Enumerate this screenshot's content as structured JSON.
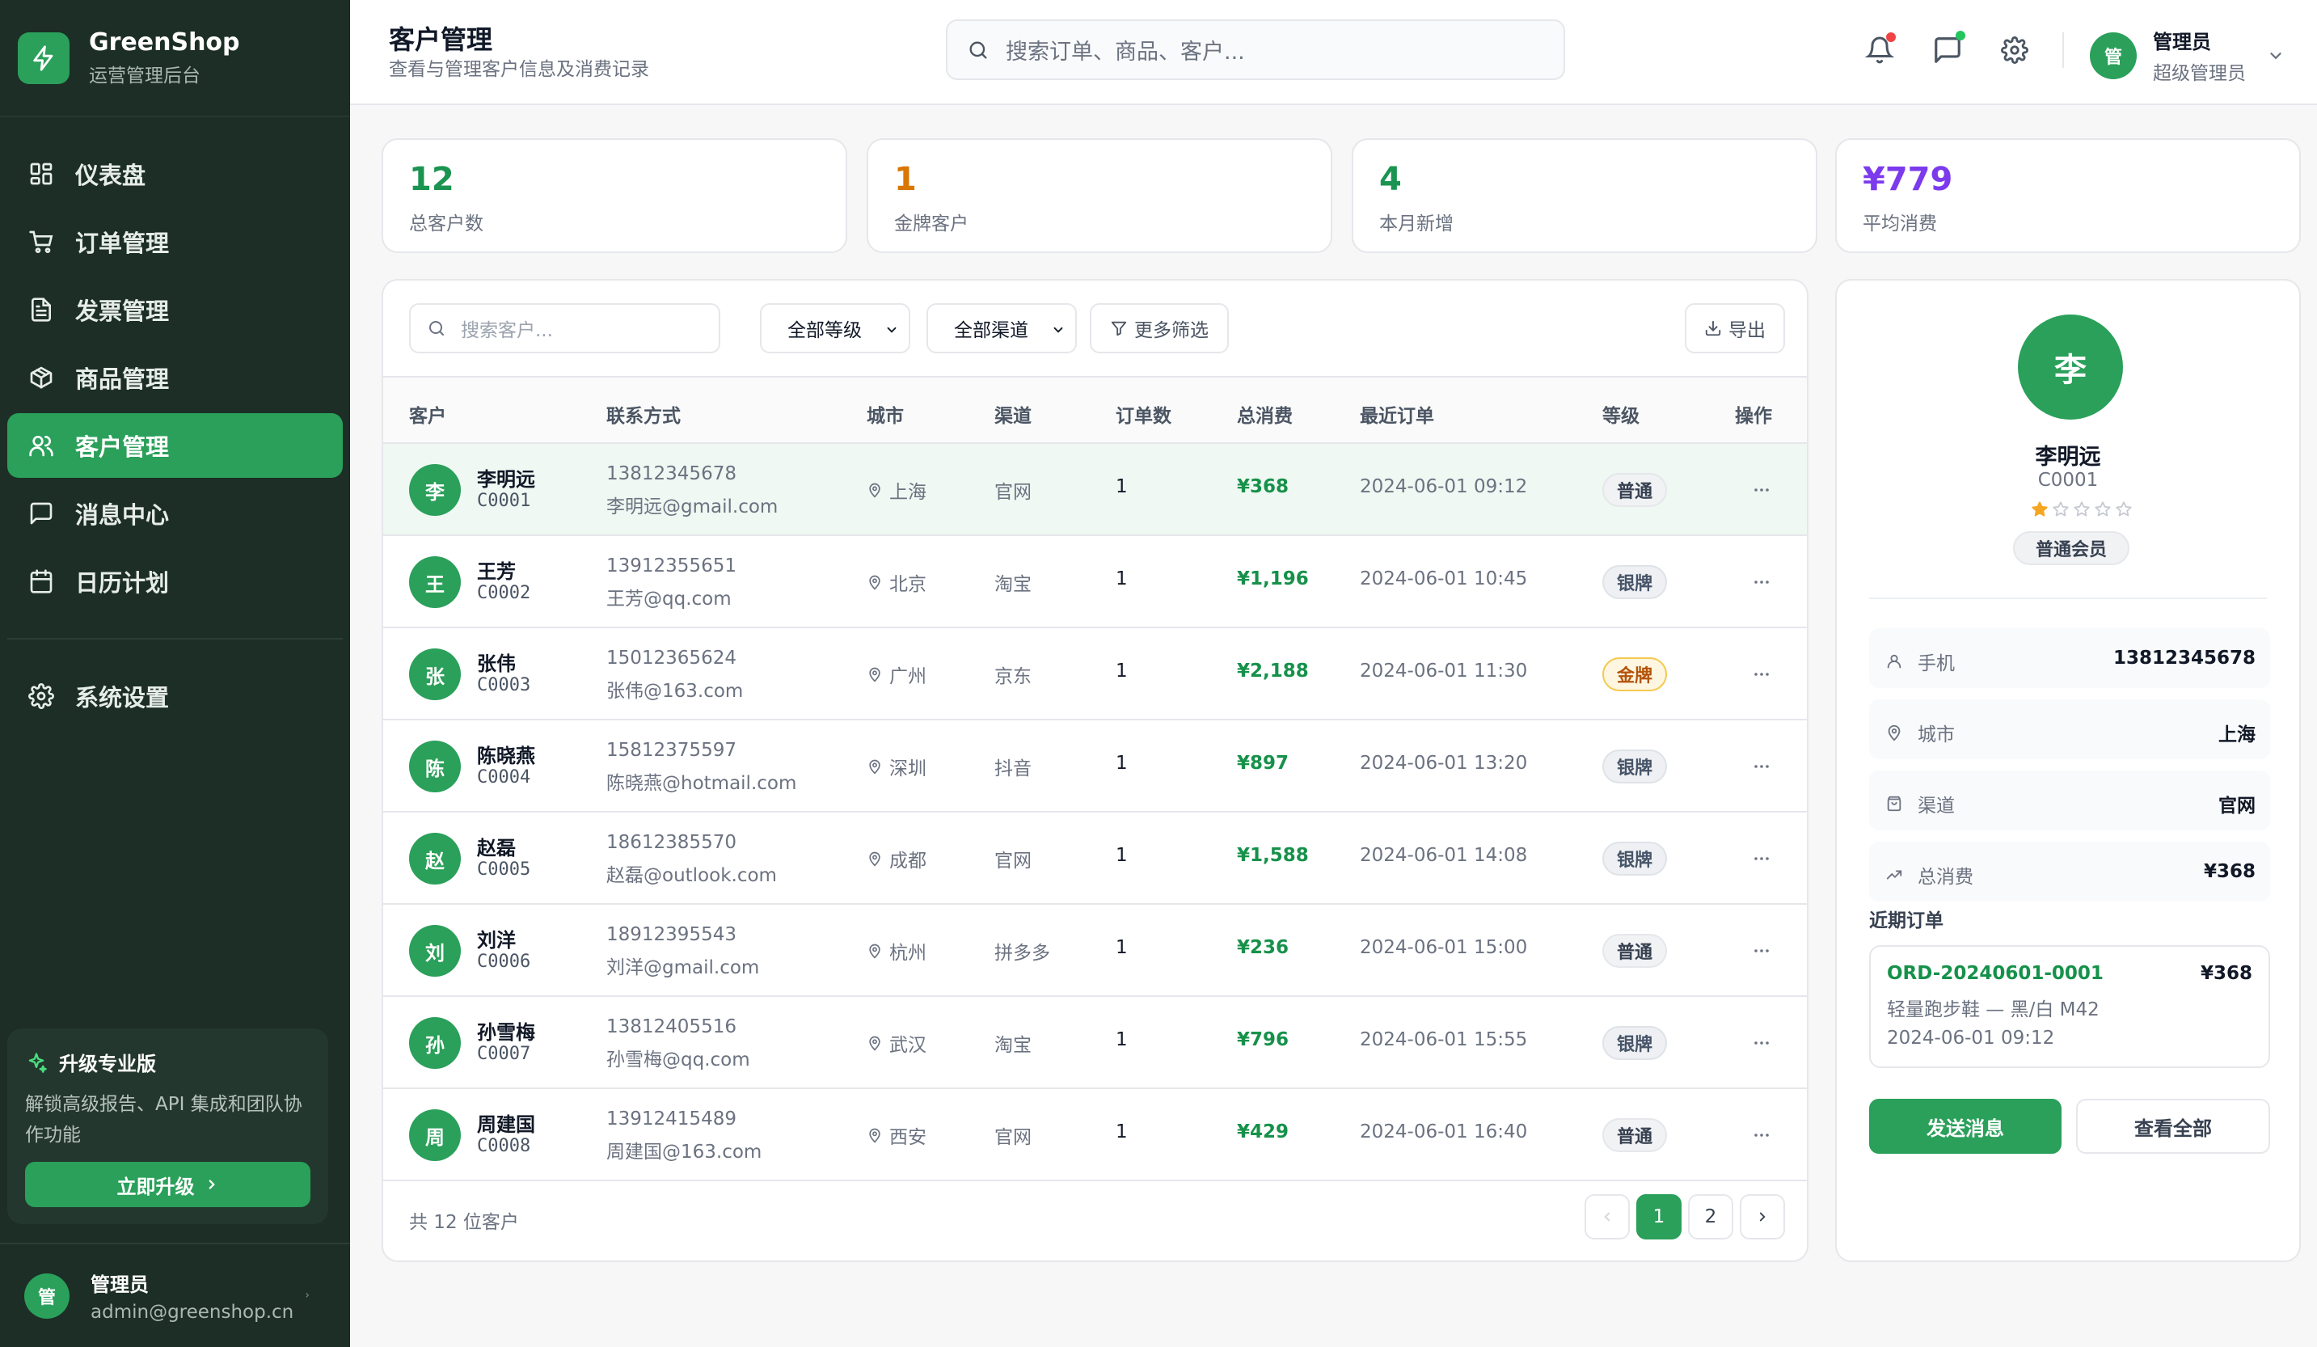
{
  "brand": {
    "name": "GreenShop",
    "subtitle": "运营管理后台"
  },
  "nav": {
    "items": [
      {
        "label": "仪表盘",
        "icon": "dashboard-icon"
      },
      {
        "label": "订单管理",
        "icon": "cart-icon"
      },
      {
        "label": "发票管理",
        "icon": "document-icon"
      },
      {
        "label": "商品管理",
        "icon": "box-icon"
      },
      {
        "label": "客户管理",
        "icon": "users-icon",
        "active": true
      },
      {
        "label": "消息中心",
        "icon": "message-icon"
      },
      {
        "label": "日历计划",
        "icon": "calendar-icon"
      }
    ],
    "settings": {
      "label": "系统设置",
      "icon": "gear-icon"
    }
  },
  "upgrade": {
    "title": "升级专业版",
    "desc": "解锁高级报告、API 集成和团队协作功能",
    "button": "立即升级"
  },
  "sidebar_user": {
    "avatar": "管",
    "name": "管理员",
    "email": "admin@greenshop.cn"
  },
  "header": {
    "title": "客户管理",
    "subtitle": "查看与管理客户信息及消费记录",
    "search_placeholder": "搜索订单、商品、客户...",
    "user": {
      "avatar": "管",
      "name": "管理员",
      "role": "超级管理员"
    }
  },
  "stats": [
    {
      "value": "12",
      "label": "总客户数",
      "color": "#1a9450"
    },
    {
      "value": "1",
      "label": "金牌客户",
      "color": "#d97706"
    },
    {
      "value": "4",
      "label": "本月新增",
      "color": "#1a9450"
    },
    {
      "value": "¥779",
      "label": "平均消费",
      "color": "#7c3aed"
    }
  ],
  "filters": {
    "search_placeholder": "搜索客户...",
    "level_select": "全部等级",
    "channel_select": "全部渠道",
    "more_filters": "更多筛选",
    "export": "导出"
  },
  "table": {
    "columns": [
      "客户",
      "联系方式",
      "城市",
      "渠道",
      "订单数",
      "总消费",
      "最近订单",
      "等级",
      "操作"
    ],
    "rows": [
      {
        "avatar": "李",
        "name": "李明远",
        "id": "C0001",
        "phone": "13812345678",
        "email": "李明远@gmail.com",
        "city": "上海",
        "channel": "官网",
        "orders": "1",
        "total": "¥368",
        "last_order": "2024-06-01 09:12",
        "level": "普通",
        "level_type": "normal"
      },
      {
        "avatar": "王",
        "name": "王芳",
        "id": "C0002",
        "phone": "13912355651",
        "email": "王芳@qq.com",
        "city": "北京",
        "channel": "淘宝",
        "orders": "1",
        "total": "¥1,196",
        "last_order": "2024-06-01 10:45",
        "level": "银牌",
        "level_type": "silver"
      },
      {
        "avatar": "张",
        "name": "张伟",
        "id": "C0003",
        "phone": "15012365624",
        "email": "张伟@163.com",
        "city": "广州",
        "channel": "京东",
        "orders": "1",
        "total": "¥2,188",
        "last_order": "2024-06-01 11:30",
        "level": "金牌",
        "level_type": "gold"
      },
      {
        "avatar": "陈",
        "name": "陈晓燕",
        "id": "C0004",
        "phone": "15812375597",
        "email": "陈晓燕@hotmail.com",
        "city": "深圳",
        "channel": "抖音",
        "orders": "1",
        "total": "¥897",
        "last_order": "2024-06-01 13:20",
        "level": "银牌",
        "level_type": "silver"
      },
      {
        "avatar": "赵",
        "name": "赵磊",
        "id": "C0005",
        "phone": "18612385570",
        "email": "赵磊@outlook.com",
        "city": "成都",
        "channel": "官网",
        "orders": "1",
        "total": "¥1,588",
        "last_order": "2024-06-01 14:08",
        "level": "银牌",
        "level_type": "silver"
      },
      {
        "avatar": "刘",
        "name": "刘洋",
        "id": "C0006",
        "phone": "18912395543",
        "email": "刘洋@gmail.com",
        "city": "杭州",
        "channel": "拼多多",
        "orders": "1",
        "total": "¥236",
        "last_order": "2024-06-01 15:00",
        "level": "普通",
        "level_type": "normal"
      },
      {
        "avatar": "孙",
        "name": "孙雪梅",
        "id": "C0007",
        "phone": "13812405516",
        "email": "孙雪梅@qq.com",
        "city": "武汉",
        "channel": "淘宝",
        "orders": "1",
        "total": "¥796",
        "last_order": "2024-06-01 15:55",
        "level": "银牌",
        "level_type": "silver"
      },
      {
        "avatar": "周",
        "name": "周建国",
        "id": "C0008",
        "phone": "13912415489",
        "email": "周建国@163.com",
        "city": "西安",
        "channel": "官网",
        "orders": "1",
        "total": "¥429",
        "last_order": "2024-06-01 16:40",
        "level": "普通",
        "level_type": "normal"
      }
    ],
    "footer": "共 12 位客户",
    "pages": [
      "1",
      "2"
    ],
    "current_page": "1"
  },
  "detail": {
    "avatar": "李",
    "name": "李明远",
    "id": "C0001",
    "rating": 1,
    "rating_max": 5,
    "member_badge": "普通会员",
    "fields": [
      {
        "label": "手机",
        "value": "13812345678",
        "icon": "user-icon"
      },
      {
        "label": "城市",
        "value": "上海",
        "icon": "location-icon"
      },
      {
        "label": "渠道",
        "value": "官网",
        "icon": "bag-icon"
      },
      {
        "label": "总消费",
        "value": "¥368",
        "icon": "trend-icon"
      }
    ],
    "recent_title": "近期订单",
    "recent_order": {
      "id": "ORD-20240601-0001",
      "amount": "¥368",
      "product": "轻量跑步鞋 — 黑/白 M42",
      "date": "2024-06-01 09:12"
    },
    "send_button": "发送消息",
    "view_all_button": "查看全部"
  },
  "colors": {
    "accent": "#2aa05a",
    "sidebar": "#1c2e26",
    "money": "#16914a",
    "notification_dot": "#ef4444",
    "message_dot": "#22c55e"
  }
}
